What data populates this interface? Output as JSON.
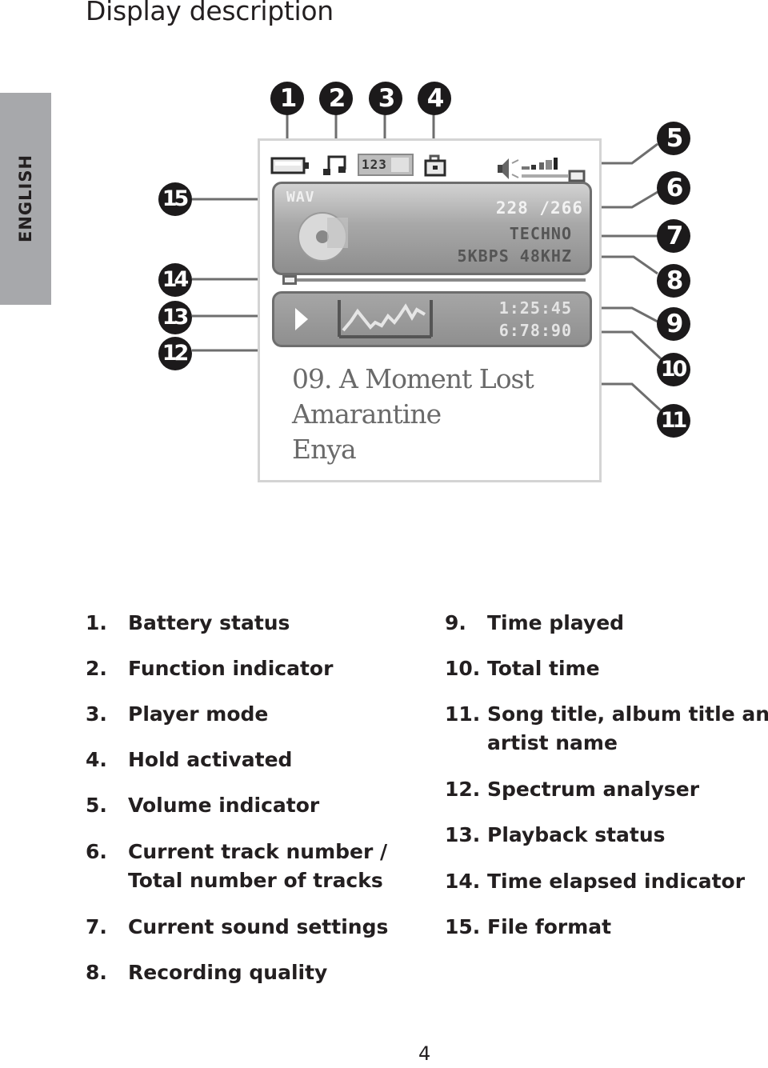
{
  "page": {
    "title": "Display description",
    "language_tab": "ENGLISH",
    "page_number": "4"
  },
  "display": {
    "file_format": "WAV",
    "track_counter": "228 /266",
    "sound_setting": "TECHNO",
    "recording_quality": "5KBPS 48KHZ",
    "time_played": "1:25:45",
    "total_time": "6:78:90",
    "player_mode": "123",
    "song_title": "09. A Moment Lost",
    "album_title": "Amarantine",
    "artist_name": "Enya",
    "playback_status": "play",
    "icons": {
      "battery": "battery-icon",
      "function": "music-note-icon",
      "player_mode": "player-mode-icon",
      "hold": "lock-icon",
      "volume": "speaker-icon",
      "album_art": "cd-disc-icon",
      "playback": "play-icon",
      "spectrum": "spectrum-analyser-icon"
    }
  },
  "callouts": [
    "1",
    "2",
    "3",
    "4",
    "5",
    "6",
    "7",
    "8",
    "9",
    "10",
    "11",
    "12",
    "13",
    "14",
    "15"
  ],
  "legend": {
    "left": [
      {
        "num": "1.",
        "label": "Battery status"
      },
      {
        "num": "2.",
        "label": "Function indicator"
      },
      {
        "num": "3.",
        "label": "Player mode"
      },
      {
        "num": "4.",
        "label": "Hold activated"
      },
      {
        "num": "5.",
        "label": "Volume indicator"
      },
      {
        "num": "6.",
        "label": "Current track number /",
        "label2": "Total number of tracks"
      },
      {
        "num": "7.",
        "label": "Current sound settings"
      },
      {
        "num": "8.",
        "label": "Recording quality"
      }
    ],
    "right": [
      {
        "num": "9.",
        "label": "Time played"
      },
      {
        "num": "10.",
        "label": "Total time"
      },
      {
        "num": "11.",
        "label": "Song title, album title and",
        "label2": "artist name"
      },
      {
        "num": "12.",
        "label": "Spectrum analyser"
      },
      {
        "num": "13.",
        "label": "Playback status"
      },
      {
        "num": "14.",
        "label": "Time elapsed indicator"
      },
      {
        "num": "15.",
        "label": "File format"
      }
    ]
  }
}
